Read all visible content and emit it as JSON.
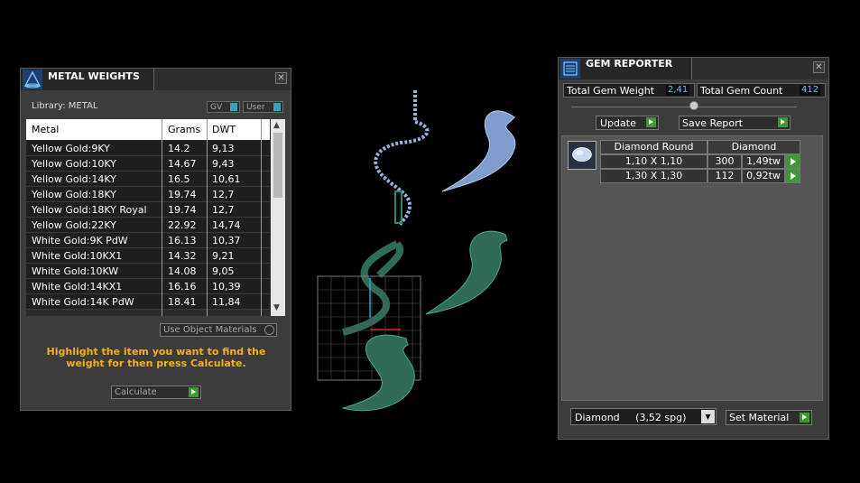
{
  "metal_weights": {
    "title": "METAL WEIGHTS",
    "library_label": "Library: METAL",
    "toggle_gv": "GV",
    "toggle_user": "User",
    "columns": [
      "Metal",
      "Grams",
      "DWT"
    ],
    "rows": [
      [
        "Yellow Gold:9KY",
        "14.2",
        "9,13"
      ],
      [
        "Yellow Gold:10KY",
        "14.67",
        "9,43"
      ],
      [
        "Yellow Gold:14KY",
        "16.5",
        "10,61"
      ],
      [
        "Yellow Gold:18KY",
        "19.74",
        "12,7"
      ],
      [
        "Yellow Gold:18KY Royal",
        "19.74",
        "12,7"
      ],
      [
        "Yellow Gold:22KY",
        "22.92",
        "14,74"
      ],
      [
        "White Gold:9K PdW",
        "16.13",
        "10,37"
      ],
      [
        "White Gold:10KX1",
        "14.32",
        "9,21"
      ],
      [
        "White Gold:10KW",
        "14.08",
        "9,05"
      ],
      [
        "White Gold:14KX1",
        "16.16",
        "10,39"
      ],
      [
        "White Gold:14K PdW",
        "18.41",
        "11,84"
      ]
    ],
    "use_object_materials": "Use Object Materials",
    "hint": "Highlight the item you want to find the weight for then press Calculate.",
    "calculate_label": "Calculate",
    "close": "✕"
  },
  "gem_reporter": {
    "title": "GEM REPORTER",
    "total_gem_weight_label": "Total Gem Weight",
    "total_gem_weight_value": "2,41",
    "total_gem_count_label": "Total Gem Count",
    "total_gem_count_value": "412",
    "update_label": "Update",
    "save_report_label": "Save Report",
    "header_cut": "Diamond Round",
    "header_material": "Diamond",
    "gems": [
      {
        "size": "1,10 X 1,10",
        "count": "300",
        "weight": "1,49tw"
      },
      {
        "size": "1,30 X 1,30",
        "count": "112",
        "weight": "0,92tw"
      }
    ],
    "material_select": "Diamond     (3,52 spg)",
    "set_material_label": "Set Material",
    "close": "✕"
  },
  "colors": {
    "accent_green": "#3b9a32",
    "value_blue": "#5ac8ff",
    "hint_orange": "#f0b020",
    "mesh_green": "#2f6b58",
    "gem_blue": "#9ab4e0"
  }
}
